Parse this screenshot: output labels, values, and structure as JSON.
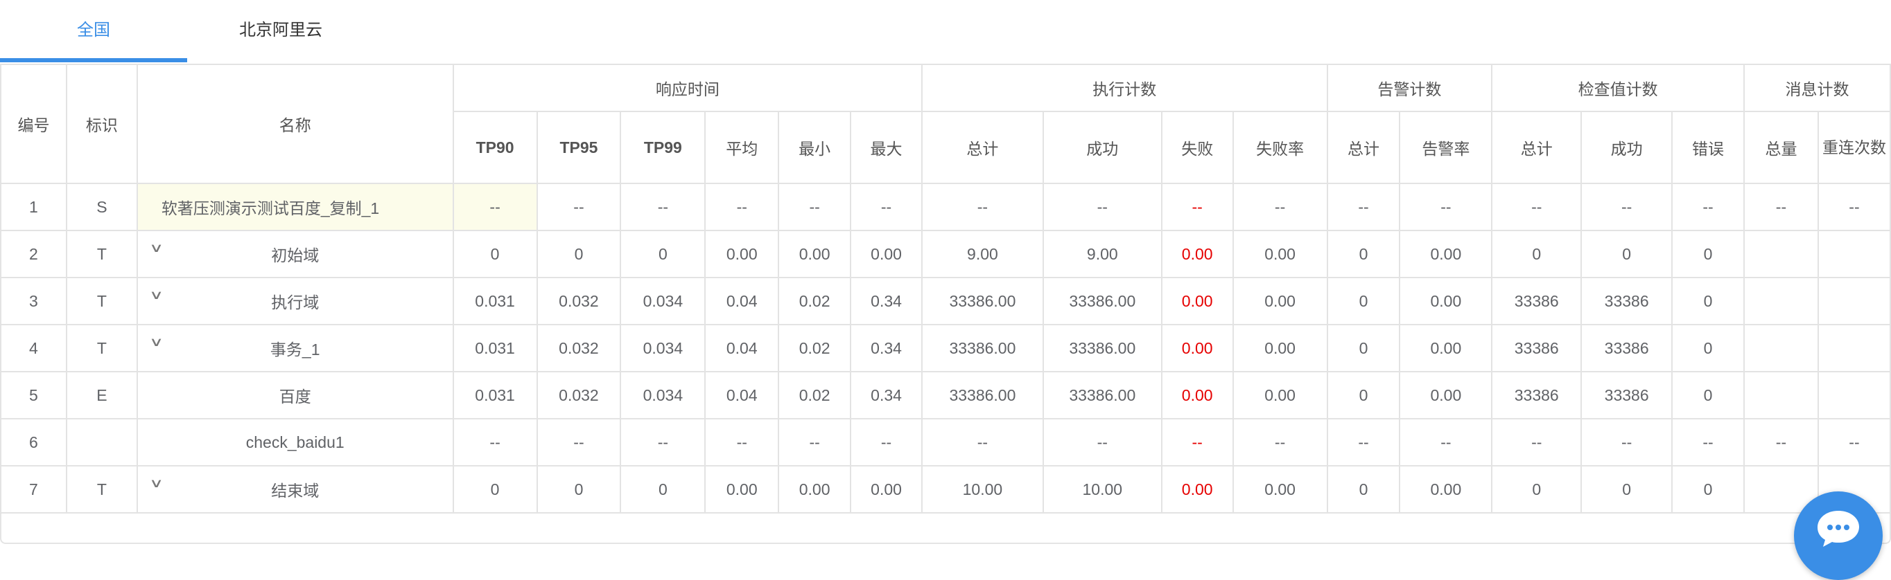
{
  "tabs": [
    {
      "label": "全国",
      "active": true
    },
    {
      "label": "北京阿里云",
      "active": false
    }
  ],
  "table": {
    "headers": {
      "id": "编号",
      "tag": "标识",
      "name": "名称",
      "groups": {
        "response": "响应时间",
        "exec": "执行计数",
        "alarm": "告警计数",
        "check": "检查值计数",
        "message": "消息计数"
      },
      "sub": {
        "tp90": "TP90",
        "tp95": "TP95",
        "tp99": "TP99",
        "avg": "平均",
        "min": "最小",
        "max": "最大",
        "exec_total": "总计",
        "exec_success": "成功",
        "exec_fail": "失败",
        "exec_fail_rate": "失败率",
        "alarm_total": "总计",
        "alarm_rate": "告警率",
        "check_total": "总计",
        "check_success": "成功",
        "check_error": "错误",
        "msg_total": "总量",
        "msg_retry": "重连次数"
      }
    },
    "rows": [
      {
        "id": "1",
        "tag": "S",
        "name": "软著压测演示测试百度_复制_1",
        "expand": false,
        "tp90": "--",
        "tp95": "--",
        "tp99": "--",
        "avg": "--",
        "min": "--",
        "max": "--",
        "exec_total": "--",
        "exec_success": "--",
        "exec_fail": "--",
        "exec_fail_rate": "--",
        "alarm_total": "--",
        "alarm_rate": "--",
        "check_total": "--",
        "check_success": "--",
        "check_error": "--",
        "msg_total": "--",
        "msg_retry": "--"
      },
      {
        "id": "2",
        "tag": "T",
        "name": "初始域",
        "expand": true,
        "tp90": "0",
        "tp95": "0",
        "tp99": "0",
        "avg": "0.00",
        "min": "0.00",
        "max": "0.00",
        "exec_total": "9.00",
        "exec_success": "9.00",
        "exec_fail": "0.00",
        "exec_fail_rate": "0.00",
        "alarm_total": "0",
        "alarm_rate": "0.00",
        "check_total": "0",
        "check_success": "0",
        "check_error": "0",
        "msg_total": "",
        "msg_retry": ""
      },
      {
        "id": "3",
        "tag": "T",
        "name": "执行域",
        "expand": true,
        "tp90": "0.031",
        "tp95": "0.032",
        "tp99": "0.034",
        "avg": "0.04",
        "min": "0.02",
        "max": "0.34",
        "exec_total": "33386.00",
        "exec_success": "33386.00",
        "exec_fail": "0.00",
        "exec_fail_rate": "0.00",
        "alarm_total": "0",
        "alarm_rate": "0.00",
        "check_total": "33386",
        "check_success": "33386",
        "check_error": "0",
        "msg_total": "",
        "msg_retry": ""
      },
      {
        "id": "4",
        "tag": "T",
        "name": "事务_1",
        "expand": true,
        "tp90": "0.031",
        "tp95": "0.032",
        "tp99": "0.034",
        "avg": "0.04",
        "min": "0.02",
        "max": "0.34",
        "exec_total": "33386.00",
        "exec_success": "33386.00",
        "exec_fail": "0.00",
        "exec_fail_rate": "0.00",
        "alarm_total": "0",
        "alarm_rate": "0.00",
        "check_total": "33386",
        "check_success": "33386",
        "check_error": "0",
        "msg_total": "",
        "msg_retry": ""
      },
      {
        "id": "5",
        "tag": "E",
        "name": "百度",
        "expand": false,
        "tp90": "0.031",
        "tp95": "0.032",
        "tp99": "0.034",
        "avg": "0.04",
        "min": "0.02",
        "max": "0.34",
        "exec_total": "33386.00",
        "exec_success": "33386.00",
        "exec_fail": "0.00",
        "exec_fail_rate": "0.00",
        "alarm_total": "0",
        "alarm_rate": "0.00",
        "check_total": "33386",
        "check_success": "33386",
        "check_error": "0",
        "msg_total": "",
        "msg_retry": ""
      },
      {
        "id": "6",
        "tag": "",
        "name": "check_baidu1",
        "expand": false,
        "tp90": "--",
        "tp95": "--",
        "tp99": "--",
        "avg": "--",
        "min": "--",
        "max": "--",
        "exec_total": "--",
        "exec_success": "--",
        "exec_fail": "--",
        "exec_fail_rate": "--",
        "alarm_total": "--",
        "alarm_rate": "--",
        "check_total": "--",
        "check_success": "--",
        "check_error": "--",
        "msg_total": "--",
        "msg_retry": "--"
      },
      {
        "id": "7",
        "tag": "T",
        "name": "结束域",
        "expand": true,
        "tp90": "0",
        "tp95": "0",
        "tp99": "0",
        "avg": "0.00",
        "min": "0.00",
        "max": "0.00",
        "exec_total": "10.00",
        "exec_success": "10.00",
        "exec_fail": "0.00",
        "exec_fail_rate": "0.00",
        "alarm_total": "0",
        "alarm_rate": "0.00",
        "check_total": "0",
        "check_success": "0",
        "check_error": "0",
        "msg_total": "",
        "msg_retry": ""
      }
    ]
  },
  "colors": {
    "accent": "#3a8ee6",
    "fail": "#e60000",
    "highlight": "#fcfcea"
  },
  "icons": {
    "expand": "chevron-down-icon",
    "chat": "chat-bubble-icon"
  }
}
